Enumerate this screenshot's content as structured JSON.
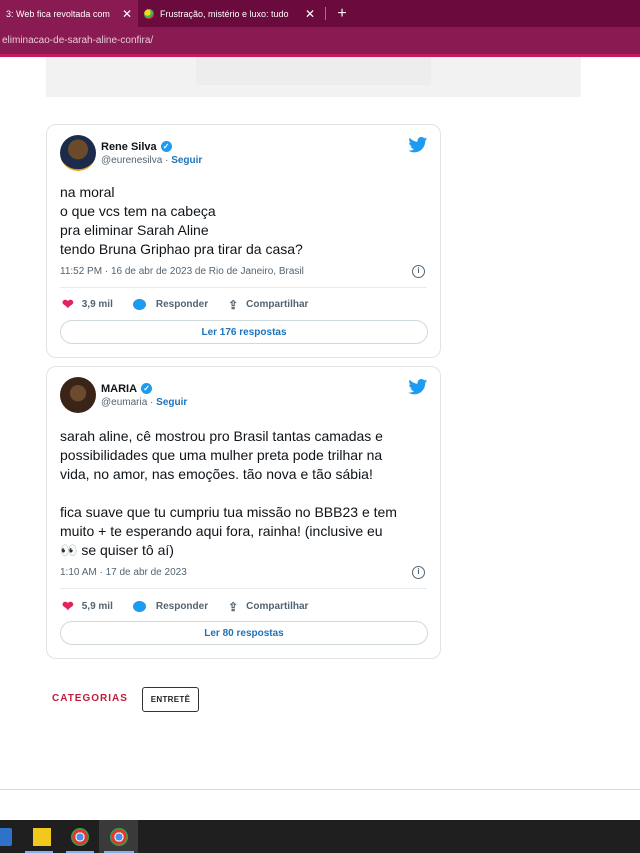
{
  "browser": {
    "tabs": [
      {
        "title": "3: Web fica revoltada com ",
        "close": "✕",
        "active": true
      },
      {
        "title": "Frustração, mistério e luxo: tudo",
        "close": "✕",
        "active": false
      }
    ],
    "new_tab": "+",
    "url": "eliminacao-de-sarah-aline-confira/"
  },
  "tweets": [
    {
      "name": "Rene Silva",
      "handle": "@eurenesilva",
      "separator": " · ",
      "follow": "Seguir",
      "lines": [
        "na moral",
        "o que vcs tem na cabeça",
        "pra eliminar Sarah Aline",
        "tendo Bruna Griphao pra tirar da casa?"
      ],
      "meta": "11:52 PM · 16 de abr de 2023 de Rio de Janeiro, Brasil",
      "likes": "3,9 mil",
      "reply": "Responder",
      "share": "Compartilhar",
      "read_replies": "Ler 176 respostas"
    },
    {
      "name": "MARIA",
      "handle": "@eumaria",
      "separator": " · ",
      "follow": "Seguir",
      "lines": [
        "sarah aline, cê mostrou pro Brasil tantas camadas e",
        "possibilidades que uma mulher preta pode trilhar na",
        "vida, no amor, nas emoções. tão nova e tão sábia!",
        "",
        "fica suave que tu cumpriu tua missão no BBB23 e tem",
        "muito + te esperando aqui fora, rainha! (inclusive eu",
        "👀 se quiser tô aí)"
      ],
      "meta": "1:10 AM · 17 de abr de 2023",
      "likes": "5,9 mil",
      "reply": "Responder",
      "share": "Compartilhar",
      "read_replies": "Ler 80 respostas"
    }
  ],
  "categories_label": "CATEGORIAS",
  "category_tag": "ENTRETÊ",
  "colors": {
    "brand": "#6b0a3c",
    "accent": "#c41b5a",
    "twitter_blue": "#1d9bf0",
    "like": "#e0245e"
  }
}
